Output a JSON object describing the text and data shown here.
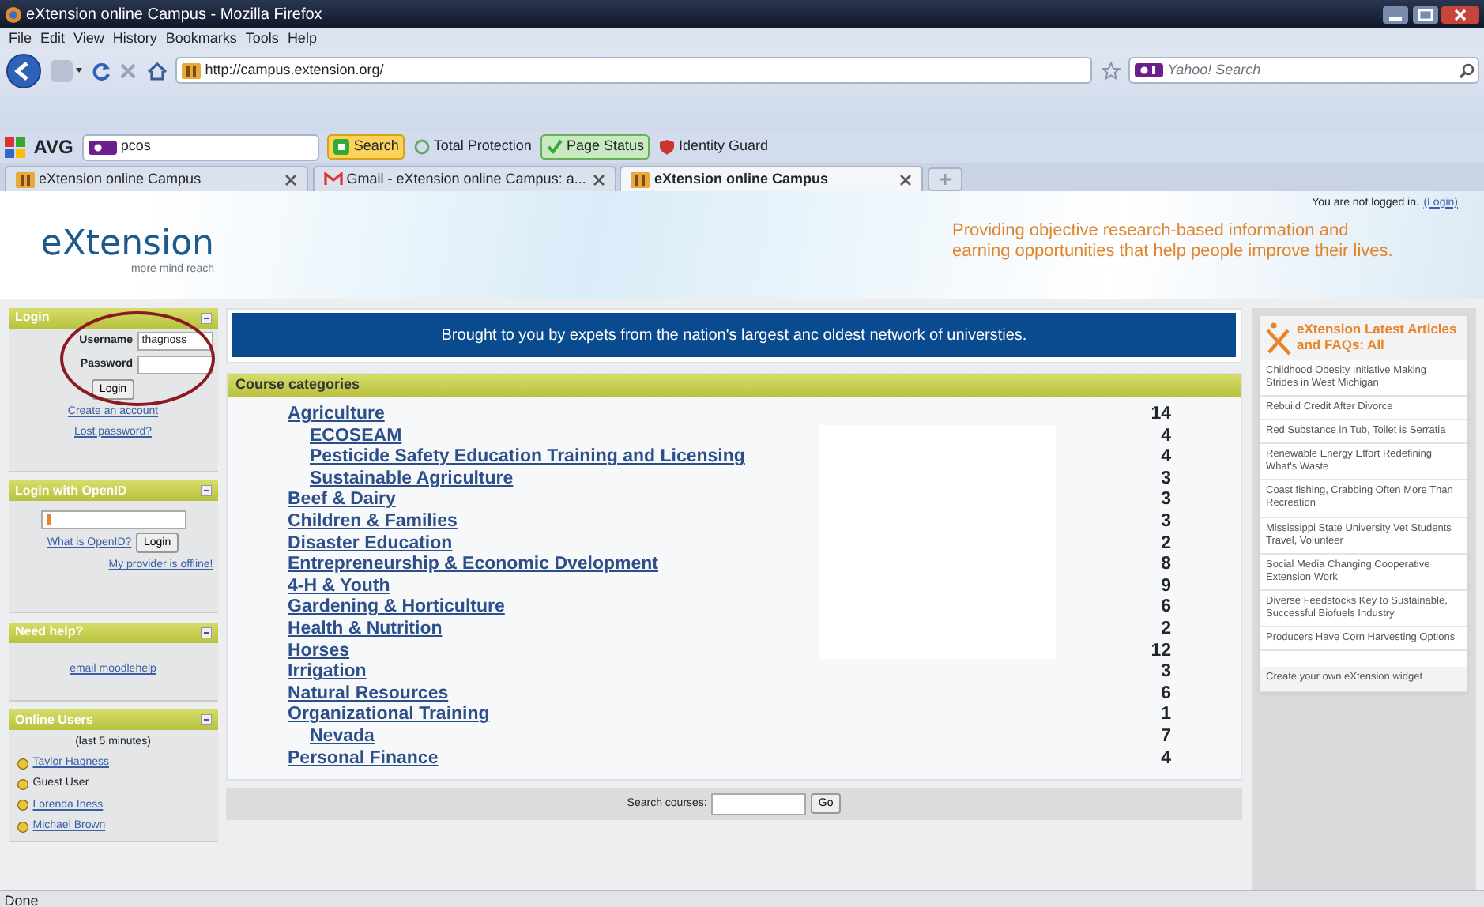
{
  "window": {
    "title": "eXtension online Campus - Mozilla Firefox"
  },
  "menu": [
    "File",
    "Edit",
    "View",
    "History",
    "Bookmarks",
    "Tools",
    "Help"
  ],
  "address": {
    "url": "http://campus.extension.org/"
  },
  "web_search": {
    "placeholder": "Yahoo! Search"
  },
  "toolbar": {
    "brand": "AVG",
    "search_value": "pcos",
    "buttons": [
      {
        "label": "Search",
        "kind": "search"
      },
      {
        "label": "Total Protection",
        "kind": "plain"
      },
      {
        "label": "Page Status",
        "kind": "status"
      },
      {
        "label": "Identity Guard",
        "kind": "guard"
      }
    ]
  },
  "tabs": [
    {
      "label": "eXtension online Campus",
      "selected": false,
      "kind": "site"
    },
    {
      "label": "Gmail - eXtension online Campus: a...",
      "selected": false,
      "kind": "mail"
    },
    {
      "label": "eXtension online Campus",
      "selected": true,
      "kind": "site"
    }
  ],
  "header": {
    "logo": "eXtension",
    "logo_tagline": "more mind reach",
    "login_notice": "You are not logged in.",
    "login_link": "(Login)",
    "slogan": "Providing objective research-based information and earning opportunities that help people improve their lives."
  },
  "login_block": {
    "title": "Login",
    "username_label": "Username",
    "username_value": "thagnoss",
    "password_label": "Password",
    "button": "Login",
    "links": [
      "Create an account",
      "Lost password?"
    ]
  },
  "openid_block": {
    "title": "Login with OpenID",
    "help_link": "What is OpenID?",
    "button": "Login",
    "offline_link": "My provider is offline!"
  },
  "help_block": {
    "title": "Need help?",
    "link": "email moodlehelp"
  },
  "online_block": {
    "title": "Online Users",
    "period": "(last 5 minutes)",
    "users": [
      {
        "name": "Taylor Hagness",
        "kind": "link"
      },
      {
        "name": "Guest User",
        "kind": "plain"
      },
      {
        "name": "Lorenda Iness",
        "kind": "link"
      },
      {
        "name": "Michael Brown",
        "kind": "link"
      }
    ]
  },
  "banner": "Brought to you by expets from the nation's largest anc oldest network of universties.",
  "categories": {
    "title": "Course categories",
    "items": [
      {
        "name": "Agriculture",
        "count": "14",
        "children": [
          {
            "name": "ECOSEAM",
            "count": "4"
          },
          {
            "name": "Pesticide Safety Education Training and Licensing",
            "count": "4"
          },
          {
            "name": "Sustainable Agriculture",
            "count": "3"
          }
        ]
      },
      {
        "name": "Beef & Dairy",
        "count": "3"
      },
      {
        "name": "Children & Families",
        "count": "3"
      },
      {
        "name": "Disaster Education",
        "count": "2"
      },
      {
        "name": "Entrepreneurship & Economic Dvelopment",
        "count": "8"
      },
      {
        "name": "4-H & Youth",
        "count": "9"
      },
      {
        "name": "Gardening & Horticulture",
        "count": "6"
      },
      {
        "name": "Health & Nutrition",
        "count": "2"
      },
      {
        "name": "Horses",
        "count": "12"
      },
      {
        "name": "Irrigation",
        "count": "3"
      },
      {
        "name": "Natural Resources",
        "count": "6"
      },
      {
        "name": "Organizational Training",
        "count": "1",
        "children": [
          {
            "name": "Nevada",
            "count": "7"
          }
        ]
      },
      {
        "name": "Personal Finance",
        "count": "4"
      }
    ]
  },
  "course_search": {
    "label": "Search courses:",
    "button": "Go"
  },
  "widget": {
    "title": "eXtension Latest Articles and FAQs: All",
    "articles": [
      "Childhood Obesity Initiative Making Strides in West Michigan",
      "Rebuild Credit After Divorce",
      "Red Substance in Tub, Toilet is Serratia",
      "Renewable Energy Effort Redefining What's Waste",
      "Coast fishing, Crabbing Often More Than Recreation",
      "Mississippi State University Vet Students Travel, Volunteer",
      "Social Media Changing Cooperative Extension Work",
      "Diverse Feedstocks Key to Sustainable, Successful Biofuels Industry",
      "Producers Have Corn Harvesting Options"
    ],
    "footer": "Create your own eXtension widget"
  },
  "status_bar": "Done"
}
